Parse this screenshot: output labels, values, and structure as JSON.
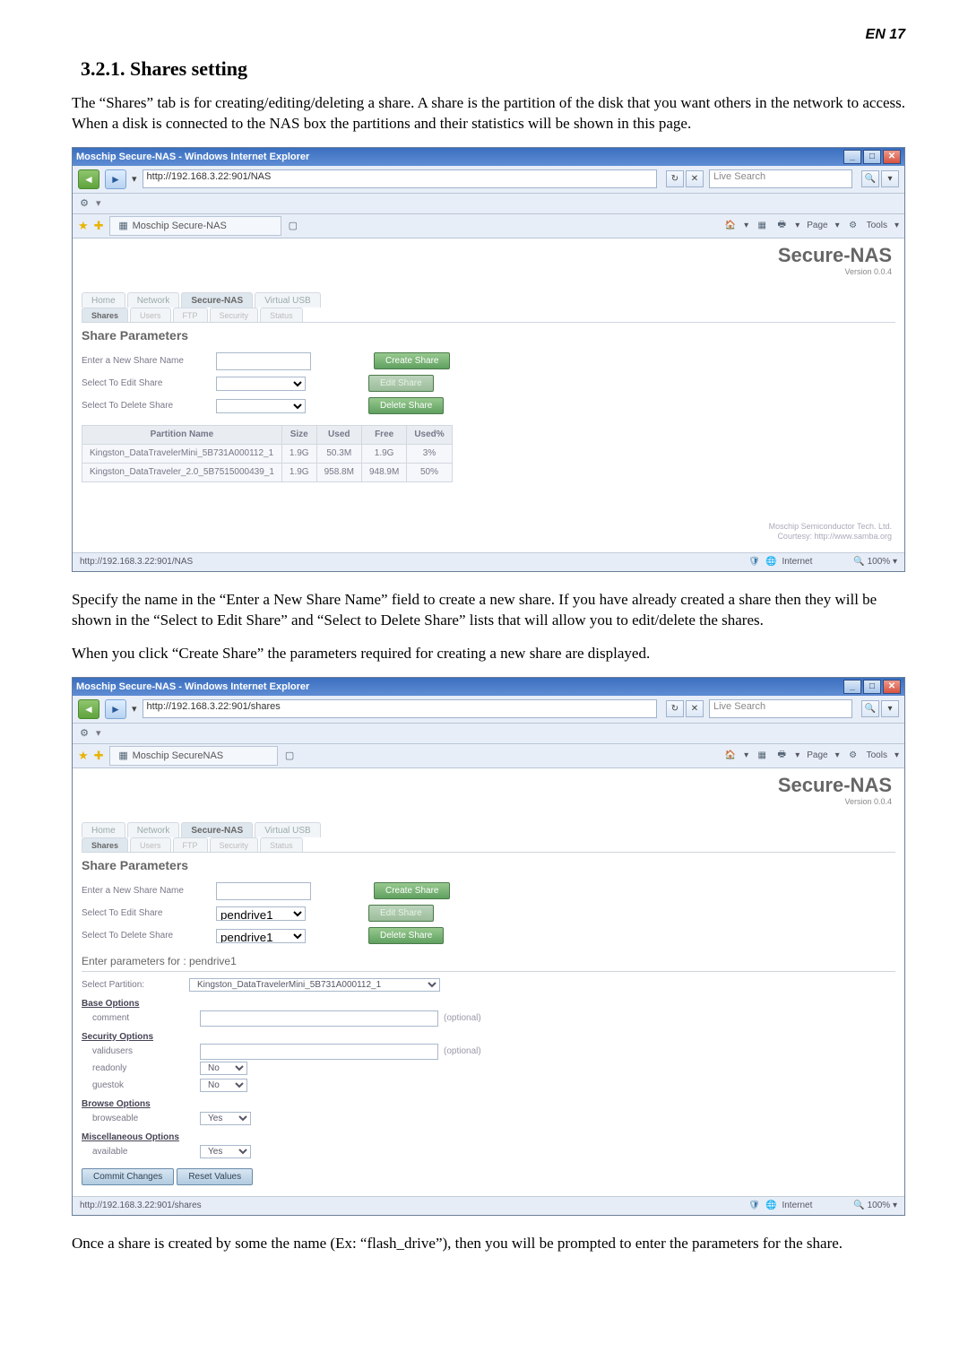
{
  "pageNumber": "EN 17",
  "heading": "3.2.1. Shares setting",
  "para1": "The “Shares” tab is for creating/editing/deleting a share. A share is the partition of the disk that you want others in the network to access. When a disk is connected to the NAS box the partitions and their statistics will be shown in this page.",
  "para2": "Specify the name in the “Enter a New Share Name” field to create a new share. If you have already created a share then they will be shown in the “Select to Edit Share” and “Select to Delete Share” lists that will allow you to edit/delete the shares.",
  "para3": "When you click “Create Share” the parameters required for creating a new share are displayed.",
  "para4": "Once a share is created by some the name (Ex: “flash_drive”), then you will be prompted to enter the parameters for the share.",
  "ie": {
    "title": "Moschip Secure-NAS - Windows Internet Explorer",
    "url": "http://192.168.3.22:901/NAS",
    "search": "Live Search",
    "tab": "Moschip Secure-NAS",
    "tools": {
      "page": "Page",
      "tools": "Tools"
    },
    "status_url": "http://192.168.3.22:901/NAS",
    "zone": "Internet",
    "zoom": "100%"
  },
  "nas": {
    "brand": "Secure-NAS",
    "version": "Version 0.0.4",
    "tabs": [
      "Home",
      "Network",
      "Secure-NAS",
      "Virtual USB"
    ],
    "subtabs": [
      "Shares",
      "Users",
      "FTP",
      "Security",
      "Status"
    ],
    "section": "Share Parameters",
    "rows": {
      "new": "Enter a New Share Name",
      "edit": "Select To Edit Share",
      "delete": "Select To Delete Share"
    },
    "btns": {
      "create": "Create Share",
      "edit": "Edit Share",
      "delete": "Delete Share"
    },
    "ptbl": {
      "headers": [
        "Partition Name",
        "Size",
        "Used",
        "Free",
        "Used%"
      ],
      "rows": [
        [
          "Kingston_DataTravelerMini_5B731A000112_1",
          "1.9G",
          "50.3M",
          "1.9G",
          "3%"
        ],
        [
          "Kingston_DataTraveler_2.0_5B7515000439_1",
          "1.9G",
          "958.8M",
          "948.9M",
          "50%"
        ]
      ]
    },
    "credit1": "Moschip Semiconductor Tech. Ltd.",
    "credit2": "Courtesy: http://www.samba.org"
  },
  "ie2": {
    "url": "http://192.168.3.22:901/shares",
    "tab": "Moschip SecureNAS",
    "status_url": "http://192.168.3.22:901/shares"
  },
  "nas2": {
    "enter_sub": "Enter parameters for : pendrive1",
    "sel_part_lbl": "Select Partition:",
    "sel_part": "Kingston_DataTravelerMini_5B731A000112_1",
    "pd": "pendrive1",
    "grp": {
      "base": "Base Options",
      "sec": "Security Options",
      "brw": "Browse Options",
      "misc": "Miscellaneous Options"
    },
    "opts": {
      "comment": "comment",
      "valid": "validusers",
      "readonly": "readonly",
      "guestok": "guestok",
      "browse": "browseable",
      "avail": "available"
    },
    "optional": "(optional)",
    "yes": "Yes",
    "no": "No",
    "commit": "Commit Changes",
    "reset": "Reset Values"
  }
}
